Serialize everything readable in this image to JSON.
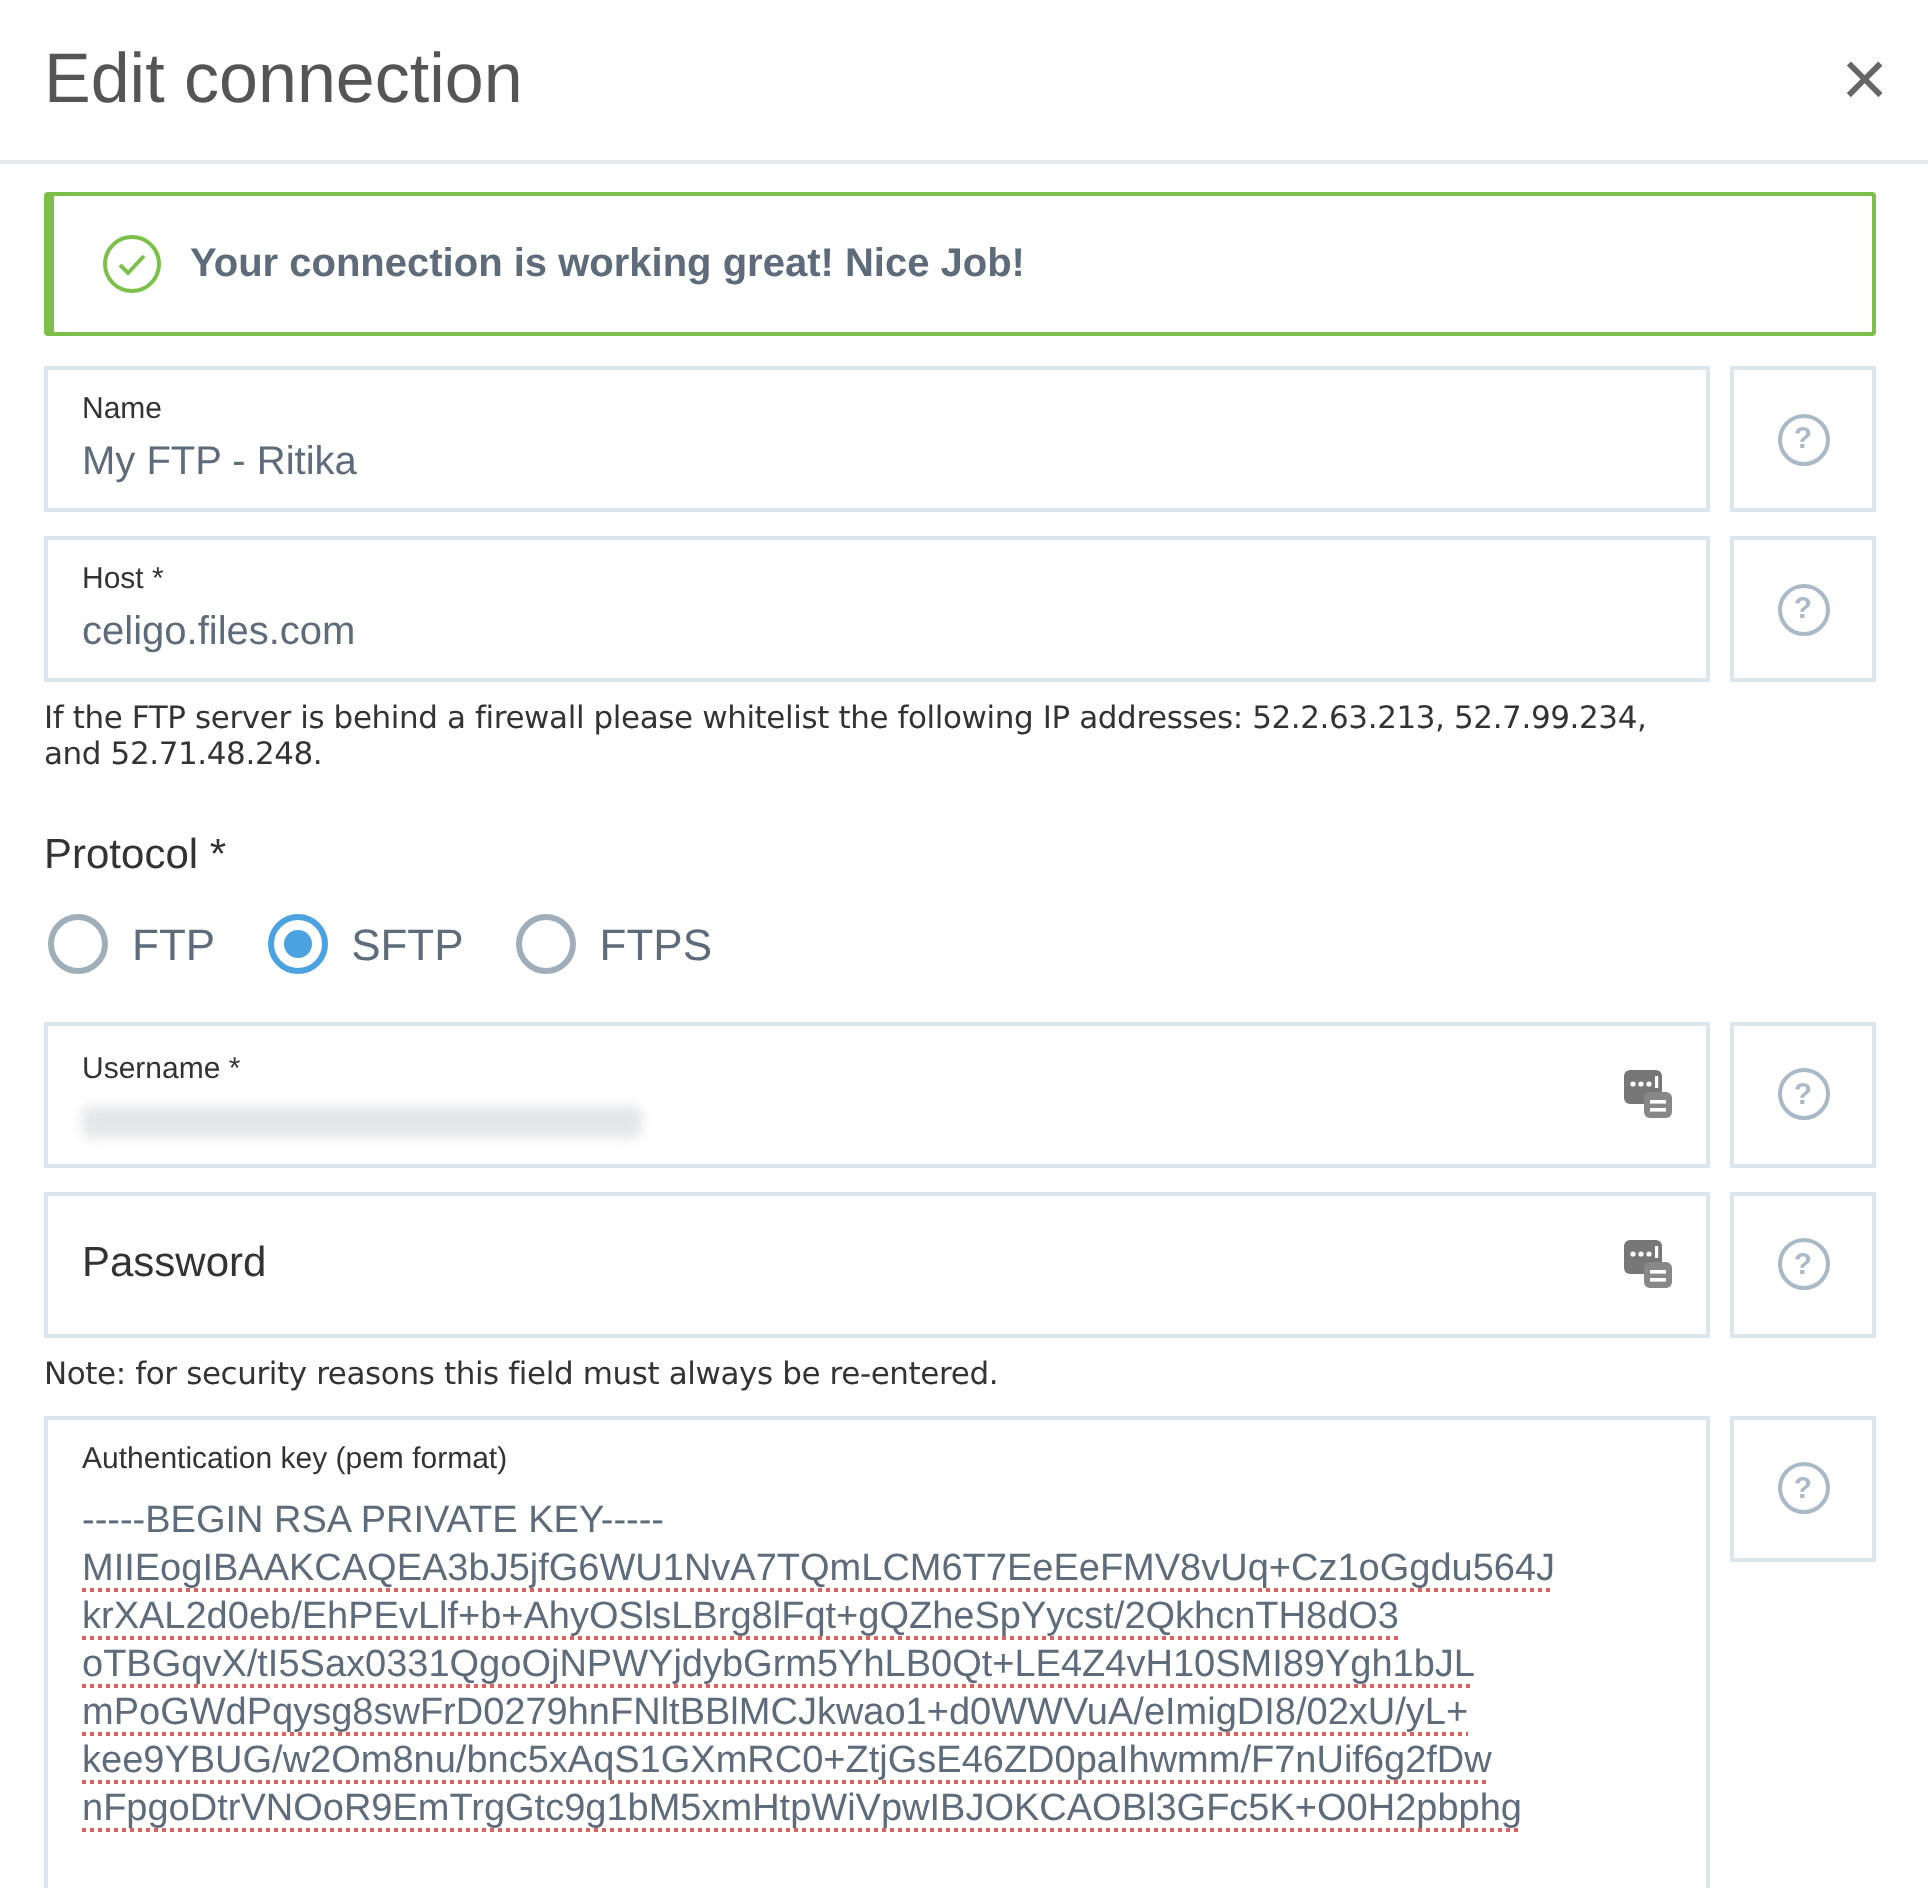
{
  "dialog": {
    "title": "Edit connection",
    "close": "×"
  },
  "banner": {
    "text": "Your connection is working great! Nice Job!"
  },
  "fields": [
    {
      "kind": "text",
      "label": "Name",
      "value": "My FTP - Ritika",
      "help": "?"
    },
    {
      "kind": "text",
      "label": "Host *",
      "value": "celigo.files.com",
      "help": "?",
      "note": "If the FTP server is behind a firewall please whitelist the following IP addresses: 52.2.63.213, 52.7.99.234, and 52.71.48.248."
    },
    {
      "kind": "radio",
      "label": "Protocol *",
      "options": [
        {
          "label": "FTP",
          "selected": false
        },
        {
          "label": "SFTP",
          "selected": true
        },
        {
          "label": "FTPS",
          "selected": false
        }
      ]
    },
    {
      "kind": "secret",
      "label": "Username *",
      "redacted": true,
      "help": "?"
    },
    {
      "kind": "secret",
      "placeholder": "Password",
      "help": "?",
      "note": "Note: for security reasons this field must always be re-entered."
    },
    {
      "kind": "multiline",
      "label": "Authentication key (pem format)",
      "help": "?",
      "lines": [
        "-----BEGIN RSA PRIVATE KEY-----",
        "MIIEogIBAAKCAQEA3bJ5jfG6WU1NvA7TQmLCM6T7EeEeFMV8vUq+Cz1oGgdu564J",
        "krXAL2d0eb/EhPEvLlf+b+AhyOSlsLBrg8lFqt+gQZheSpYycst/2QkhcnTH8dO3",
        "oTBGqvX/tI5Sax0331QgoOjNPWYjdybGrm5YhLB0Qt+LE4Z4vH10SMI89Ygh1bJL",
        "mPoGWdPqysg8swFrD0279hnFNltBBlMCJkwao1+d0WWVuA/eImigDI8/02xU/yL+",
        "kee9YBUG/w2Om8nu/bnc5xAqS1GXmRC0+ZtjGsE46ZD0paIhwmm/F7nUif6g2fDw",
        "nFpgoDtrVNOoR9EmTrgGtc9g1bM5xmHtpWiVpwIBJOKCAOBl3GFc5K+O0H2pbphg"
      ]
    }
  ]
}
